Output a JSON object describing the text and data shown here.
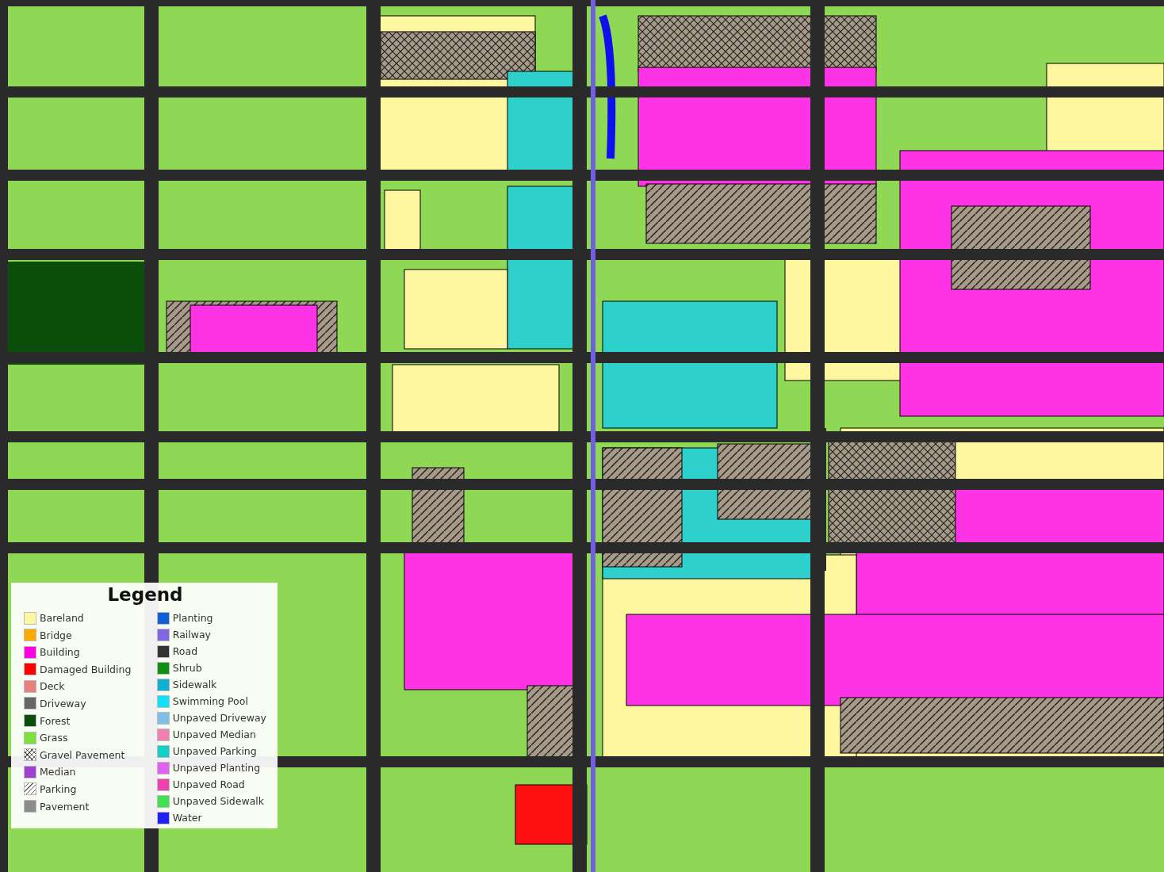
{
  "legend": {
    "title": "Legend",
    "columns": [
      [
        {
          "label": "Bareland",
          "kind": "solid",
          "color": "#fff7a0"
        },
        {
          "label": "Bridge",
          "kind": "solid",
          "color": "#ffaa00"
        },
        {
          "label": "Building",
          "kind": "solid",
          "color": "#ff00e6"
        },
        {
          "label": "Damaged Building",
          "kind": "solid",
          "color": "#ff0000"
        },
        {
          "label": "Deck",
          "kind": "solid",
          "color": "#e88080"
        },
        {
          "label": "Driveway",
          "kind": "solid",
          "color": "#666666"
        },
        {
          "label": "Forest",
          "kind": "solid",
          "color": "#0b4d0b"
        },
        {
          "label": "Grass",
          "kind": "solid",
          "color": "#7de03c"
        },
        {
          "label": "Gravel Pavement",
          "kind": "crosshatch"
        },
        {
          "label": "Median",
          "kind": "solid",
          "color": "#a040d0"
        },
        {
          "label": "Parking",
          "kind": "hatch"
        },
        {
          "label": "Pavement",
          "kind": "solid",
          "color": "#8c8c8c"
        }
      ],
      [
        {
          "label": "Planting",
          "kind": "solid",
          "color": "#1060d8"
        },
        {
          "label": "Railway",
          "kind": "solid",
          "color": "#8066e0"
        },
        {
          "label": "Road",
          "kind": "solid",
          "color": "#333333"
        },
        {
          "label": "Shrub",
          "kind": "solid",
          "color": "#109010"
        },
        {
          "label": "Sidewalk",
          "kind": "solid",
          "color": "#10b0d0"
        },
        {
          "label": "Swimming Pool",
          "kind": "solid",
          "color": "#10e0f8"
        },
        {
          "label": "Unpaved Driveway",
          "kind": "solid",
          "color": "#80c0e8"
        },
        {
          "label": "Unpaved Median",
          "kind": "solid",
          "color": "#f080b0"
        },
        {
          "label": "Unpaved Parking",
          "kind": "solid",
          "color": "#10d0c8"
        },
        {
          "label": "Unpaved Planting",
          "kind": "solid",
          "color": "#e060f0"
        },
        {
          "label": "Unpaved Road",
          "kind": "solid",
          "color": "#f040b0"
        },
        {
          "label": "Unpaved Sidewalk",
          "kind": "solid",
          "color": "#40e050"
        },
        {
          "label": "Water",
          "kind": "solid",
          "color": "#2020ff"
        }
      ]
    ]
  }
}
